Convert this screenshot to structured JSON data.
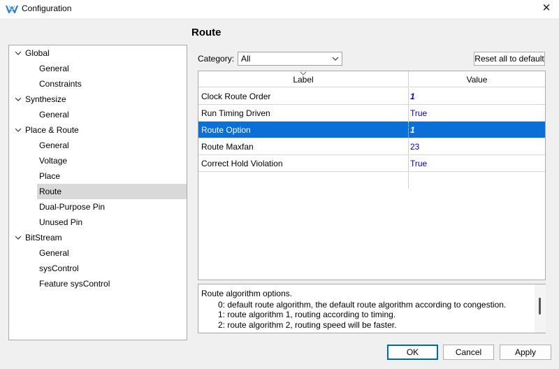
{
  "window": {
    "title": "Configuration",
    "close_glyph": "✕"
  },
  "tree": {
    "items": [
      {
        "label": "Global"
      },
      {
        "label": "General"
      },
      {
        "label": "Constraints"
      },
      {
        "label": "Synthesize"
      },
      {
        "label": "General"
      },
      {
        "label": "Place & Route"
      },
      {
        "label": "General"
      },
      {
        "label": "Voltage"
      },
      {
        "label": "Place"
      },
      {
        "label": "Route"
      },
      {
        "label": "Dual-Purpose Pin"
      },
      {
        "label": "Unused Pin"
      },
      {
        "label": "BitStream"
      },
      {
        "label": "General"
      },
      {
        "label": "sysControl"
      },
      {
        "label": "Feature sysControl"
      }
    ]
  },
  "page": {
    "title": "Route",
    "category_label": "Category:",
    "category_value": "All",
    "reset_label": "Reset all to default"
  },
  "grid": {
    "headers": {
      "label": "Label",
      "value": "Value"
    },
    "rows": [
      {
        "label": "Clock Route Order",
        "value": "1"
      },
      {
        "label": "Run Timing Driven",
        "value": "True"
      },
      {
        "label": "Route Option",
        "value": "1"
      },
      {
        "label": "Route Maxfan",
        "value": "23"
      },
      {
        "label": "Correct Hold Violation",
        "value": "True"
      }
    ]
  },
  "description": {
    "lines": [
      "Route algorithm options.",
      "0: default route algorithm, the default route algorithm according to congestion.",
      "1: route algorithm 1, routing according to timing.",
      "2: route algorithm 2, routing speed will be faster."
    ]
  },
  "buttons": {
    "ok": "OK",
    "cancel": "Cancel",
    "apply": "Apply"
  },
  "colors": {
    "selection": "#0a6fd6",
    "value_text": "#0000d0",
    "tree_selection": "#d9d9d9"
  },
  "icons": {
    "app": "gowin-logo-icon",
    "close": "close-icon",
    "chevron": "chevron-down-icon"
  }
}
